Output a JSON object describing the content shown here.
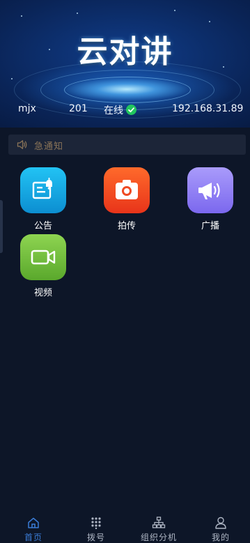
{
  "header": {
    "title": "云对讲",
    "user_name": "mjx",
    "extension": "201",
    "status": "在线",
    "ip_address": "192.168.31.89"
  },
  "notice": {
    "text": "急通知"
  },
  "apps": [
    {
      "label": "公告",
      "icon": "announcement-icon",
      "color": "#13a7e0"
    },
    {
      "label": "拍传",
      "icon": "camera-icon",
      "color": "#f0431d"
    },
    {
      "label": "广播",
      "icon": "megaphone-icon",
      "color": "#8e7ef2"
    },
    {
      "label": "视频",
      "icon": "video-camera-icon",
      "color": "#6fbf3b"
    }
  ],
  "tabbar": {
    "items": [
      {
        "label": "首页",
        "icon": "home-icon",
        "active": true
      },
      {
        "label": "拨号",
        "icon": "dialpad-icon",
        "active": false
      },
      {
        "label": "组织分机",
        "icon": "org-tree-icon",
        "active": false
      },
      {
        "label": "我的",
        "icon": "user-icon",
        "active": false
      }
    ]
  },
  "colors": {
    "background": "#0d1628",
    "accent": "#3a7bd5",
    "online": "#22c55e"
  }
}
